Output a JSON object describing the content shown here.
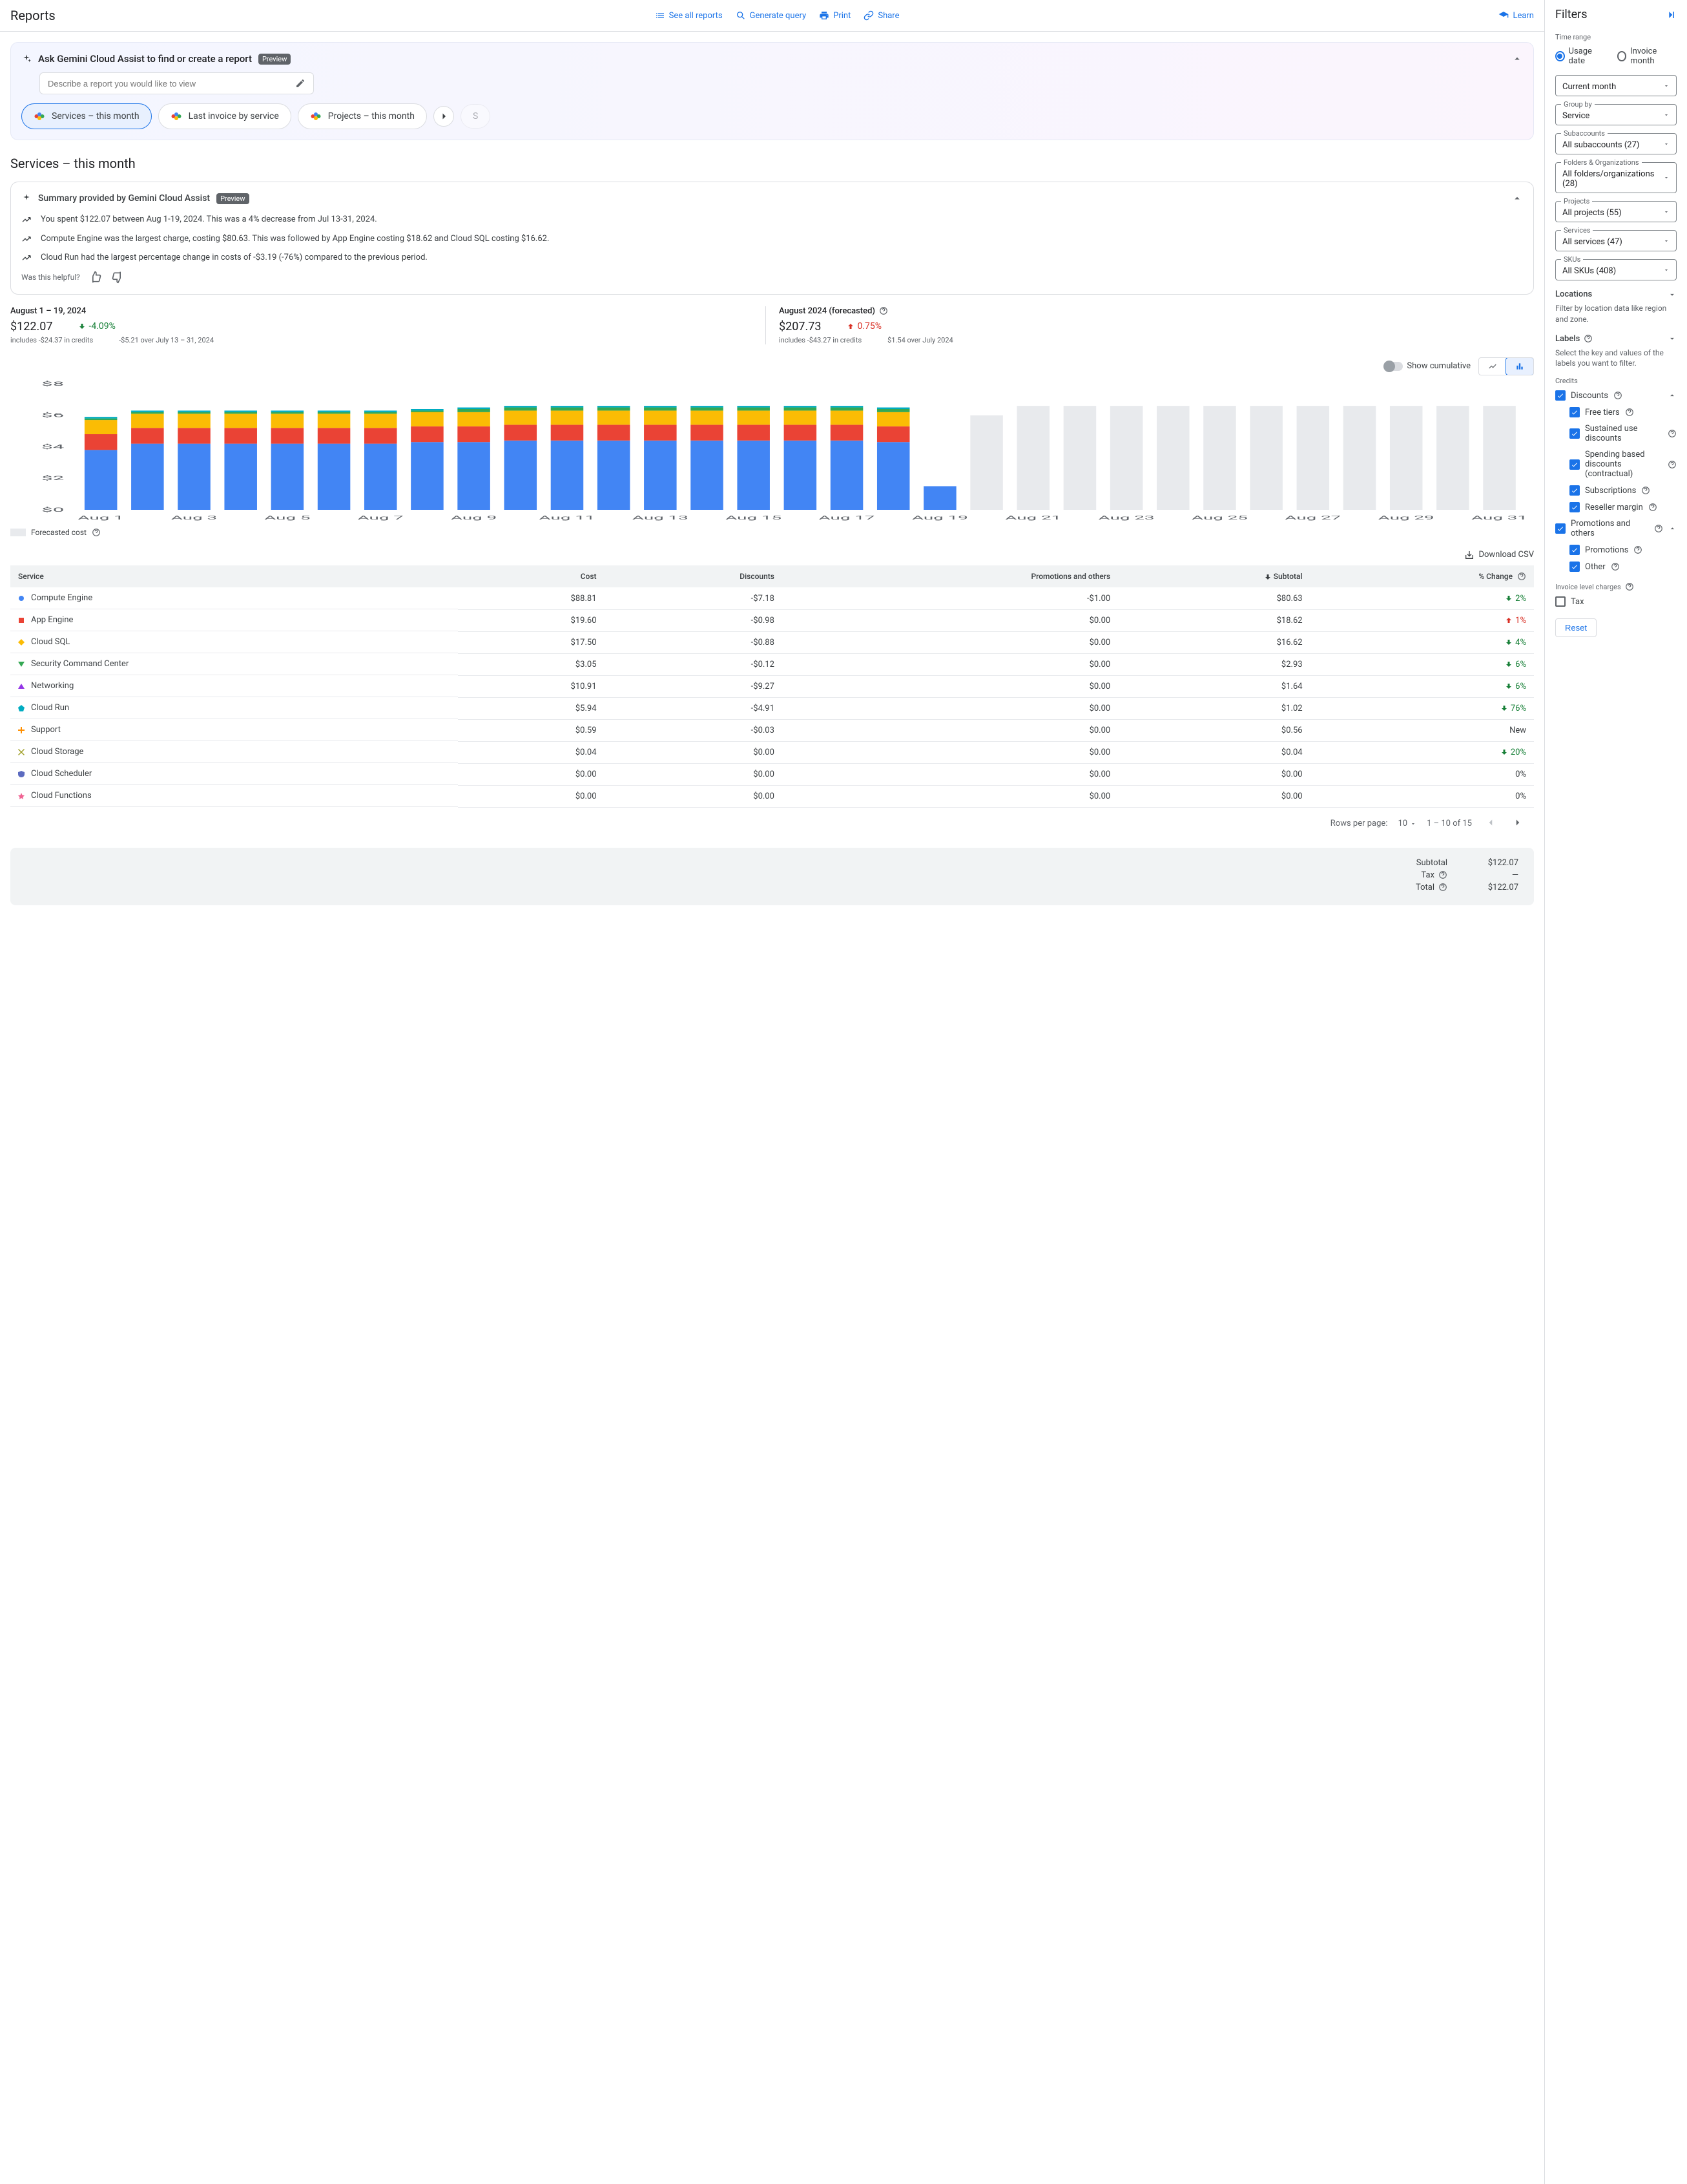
{
  "header": {
    "title": "Reports",
    "see_all": "See all reports",
    "generate": "Generate query",
    "print": "Print",
    "share": "Share",
    "learn": "Learn"
  },
  "gemini": {
    "title": "Ask Gemini Cloud Assist to find or create a report",
    "preview": "Preview",
    "placeholder": "Describe a report you would like to view",
    "chips": [
      "Services – this month",
      "Last invoice by service",
      "Projects – this month"
    ]
  },
  "page_title": "Services – this month",
  "summary": {
    "title": "Summary provided by Gemini Cloud Assist",
    "preview": "Preview",
    "items": [
      "You spent $122.07 between Aug 1-19, 2024. This was a 4% decrease from Jul 13-31, 2024.",
      "Compute Engine was the largest charge, costing $80.63. This was followed by App Engine costing $18.62 and Cloud SQL costing $16.62.",
      "Cloud Run had the largest percentage change in costs of -$3.19 (-76%) compared to the previous period."
    ],
    "helpful": "Was this helpful?"
  },
  "metrics": {
    "left": {
      "label": "August 1 – 19, 2024",
      "value": "$122.07",
      "credits": "includes -$24.37 in credits",
      "change": "-4.09%",
      "change_dir": "down",
      "change_sub": "-$5.21 over July 13 – 31, 2024"
    },
    "right": {
      "label": "August 2024 (forecasted)",
      "value": "$207.73",
      "credits": "includes -$43.27 in credits",
      "change": "0.75%",
      "change_dir": "up",
      "change_sub": "$1.54 over July 2024"
    }
  },
  "chart_controls": {
    "cumulative": "Show cumulative"
  },
  "chart_data": {
    "type": "bar",
    "ylabel": "$",
    "ylim": [
      0,
      8
    ],
    "yticks": [
      "$0",
      "$2",
      "$4",
      "$6",
      "$8"
    ],
    "categories": [
      "Aug 1",
      "Aug 2",
      "Aug 3",
      "Aug 4",
      "Aug 5",
      "Aug 6",
      "Aug 7",
      "Aug 8",
      "Aug 9",
      "Aug 10",
      "Aug 11",
      "Aug 12",
      "Aug 13",
      "Aug 14",
      "Aug 15",
      "Aug 16",
      "Aug 17",
      "Aug 18",
      "Aug 19",
      "Aug 20",
      "Aug 21",
      "Aug 22",
      "Aug 23",
      "Aug 24",
      "Aug 25",
      "Aug 26",
      "Aug 27",
      "Aug 28",
      "Aug 29",
      "Aug 30",
      "Aug 31"
    ],
    "xtick_labels": [
      "Aug 1",
      "Aug 3",
      "Aug 5",
      "Aug 7",
      "Aug 9",
      "Aug 11",
      "Aug 13",
      "Aug 15",
      "Aug 17",
      "Aug 19",
      "Aug 21",
      "Aug 23",
      "Aug 25",
      "Aug 27",
      "Aug 29",
      "Aug 31"
    ],
    "series": [
      {
        "name": "Compute Engine",
        "color": "#4285f4",
        "values": [
          3.8,
          4.2,
          4.2,
          4.2,
          4.2,
          4.2,
          4.2,
          4.3,
          4.3,
          4.4,
          4.4,
          4.4,
          4.4,
          4.4,
          4.4,
          4.4,
          4.4,
          4.3,
          1.5
        ]
      },
      {
        "name": "App Engine",
        "color": "#ea4335",
        "values": [
          1.0,
          1.0,
          1.0,
          1.0,
          1.0,
          1.0,
          1.0,
          1.0,
          1.0,
          1.0,
          1.0,
          1.0,
          1.0,
          1.0,
          1.0,
          1.0,
          1.0,
          1.0,
          0.0
        ]
      },
      {
        "name": "Cloud SQL",
        "color": "#fbbc04",
        "values": [
          0.9,
          0.9,
          0.9,
          0.9,
          0.9,
          0.9,
          0.9,
          0.9,
          0.9,
          0.9,
          0.9,
          0.9,
          0.9,
          0.9,
          0.9,
          0.9,
          0.9,
          0.9,
          0.0
        ]
      },
      {
        "name": "Security Command Center",
        "color": "#34a853",
        "values": [
          0.1,
          0.1,
          0.1,
          0.1,
          0.1,
          0.1,
          0.1,
          0.1,
          0.2,
          0.2,
          0.2,
          0.2,
          0.2,
          0.2,
          0.2,
          0.2,
          0.2,
          0.2,
          0.0
        ]
      },
      {
        "name": "Other",
        "color": "#00acc1",
        "values": [
          0.1,
          0.1,
          0.1,
          0.1,
          0.1,
          0.1,
          0.1,
          0.1,
          0.1,
          0.1,
          0.1,
          0.1,
          0.1,
          0.1,
          0.1,
          0.1,
          0.1,
          0.1,
          0.0
        ]
      }
    ],
    "forecast": {
      "color": "#e8eaed",
      "values": [
        null,
        null,
        null,
        null,
        null,
        null,
        null,
        null,
        null,
        null,
        null,
        null,
        null,
        null,
        null,
        null,
        null,
        null,
        null,
        6.0,
        6.6,
        6.6,
        6.6,
        6.6,
        6.6,
        6.6,
        6.6,
        6.6,
        6.6,
        6.6,
        6.6
      ]
    },
    "legend": {
      "forecast": "Forecasted cost"
    }
  },
  "download_csv": "Download CSV",
  "table": {
    "headers": [
      "Service",
      "Cost",
      "Discounts",
      "Promotions and others",
      "Subtotal",
      "% Change"
    ],
    "rows": [
      {
        "marker": "#4285f4",
        "shape": "circle",
        "name": "Compute Engine",
        "cost": "$88.81",
        "discounts": "-$7.18",
        "promo": "-$1.00",
        "subtotal": "$80.63",
        "pct": "2%",
        "dir": "down"
      },
      {
        "marker": "#ea4335",
        "shape": "square",
        "name": "App Engine",
        "cost": "$19.60",
        "discounts": "-$0.98",
        "promo": "$0.00",
        "subtotal": "$18.62",
        "pct": "1%",
        "dir": "up"
      },
      {
        "marker": "#fbbc04",
        "shape": "diamond",
        "name": "Cloud SQL",
        "cost": "$17.50",
        "discounts": "-$0.88",
        "promo": "$0.00",
        "subtotal": "$16.62",
        "pct": "4%",
        "dir": "down"
      },
      {
        "marker": "#34a853",
        "shape": "triangle-down",
        "name": "Security Command Center",
        "cost": "$3.05",
        "discounts": "-$0.12",
        "promo": "$0.00",
        "subtotal": "$2.93",
        "pct": "6%",
        "dir": "down"
      },
      {
        "marker": "#9334e6",
        "shape": "triangle-up",
        "name": "Networking",
        "cost": "$10.91",
        "discounts": "-$9.27",
        "promo": "$0.00",
        "subtotal": "$1.64",
        "pct": "6%",
        "dir": "down"
      },
      {
        "marker": "#00acc1",
        "shape": "pentagon",
        "name": "Cloud Run",
        "cost": "$5.94",
        "discounts": "-$4.91",
        "promo": "$0.00",
        "subtotal": "$1.02",
        "pct": "76%",
        "dir": "down"
      },
      {
        "marker": "#ff8f00",
        "shape": "plus",
        "name": "Support",
        "cost": "$0.59",
        "discounts": "-$0.03",
        "promo": "$0.00",
        "subtotal": "$0.56",
        "pct": "New",
        "dir": "neutral"
      },
      {
        "marker": "#9e9d24",
        "shape": "cross",
        "name": "Cloud Storage",
        "cost": "$0.04",
        "discounts": "$0.00",
        "promo": "$0.00",
        "subtotal": "$0.04",
        "pct": "20%",
        "dir": "down"
      },
      {
        "marker": "#5c6bc0",
        "shape": "shield",
        "name": "Cloud Scheduler",
        "cost": "$0.00",
        "discounts": "$0.00",
        "promo": "$0.00",
        "subtotal": "$0.00",
        "pct": "0%",
        "dir": "neutral"
      },
      {
        "marker": "#f06292",
        "shape": "star",
        "name": "Cloud Functions",
        "cost": "$0.00",
        "discounts": "$0.00",
        "promo": "$0.00",
        "subtotal": "$0.00",
        "pct": "0%",
        "dir": "neutral"
      }
    ],
    "pagination": {
      "rows_per_page_label": "Rows per page:",
      "rows_per_page": "10",
      "range": "1 – 10 of 15"
    }
  },
  "totals": {
    "subtotal_label": "Subtotal",
    "subtotal": "$122.07",
    "tax_label": "Tax",
    "tax": "—",
    "total_label": "Total",
    "total": "$122.07"
  },
  "filters": {
    "title": "Filters",
    "time_range": "Time range",
    "usage_date": "Usage date",
    "invoice_month": "Invoice month",
    "time_value": "Current month",
    "group_by_label": "Group by",
    "group_by": "Service",
    "subaccounts_label": "Subaccounts",
    "subaccounts": "All subaccounts (27)",
    "folders_label": "Folders & Organizations",
    "folders": "All folders/organizations (28)",
    "projects_label": "Projects",
    "projects": "All projects (55)",
    "services_label": "Services",
    "services": "All services (47)",
    "skus_label": "SKUs",
    "skus": "All SKUs (408)",
    "locations": "Locations",
    "locations_desc": "Filter by location data like region and zone.",
    "labels": "Labels",
    "labels_desc": "Select the key and values of the labels you want to filter.",
    "credits": "Credits",
    "discounts": "Discounts",
    "free_tiers": "Free tiers",
    "sustained": "Sustained use discounts",
    "spending": "Spending based discounts (contractual)",
    "subscriptions": "Subscriptions",
    "reseller": "Reseller margin",
    "promotions_others": "Promotions and others",
    "promotions": "Promotions",
    "other": "Other",
    "invoice_level": "Invoice level charges",
    "tax": "Tax",
    "reset": "Reset"
  }
}
